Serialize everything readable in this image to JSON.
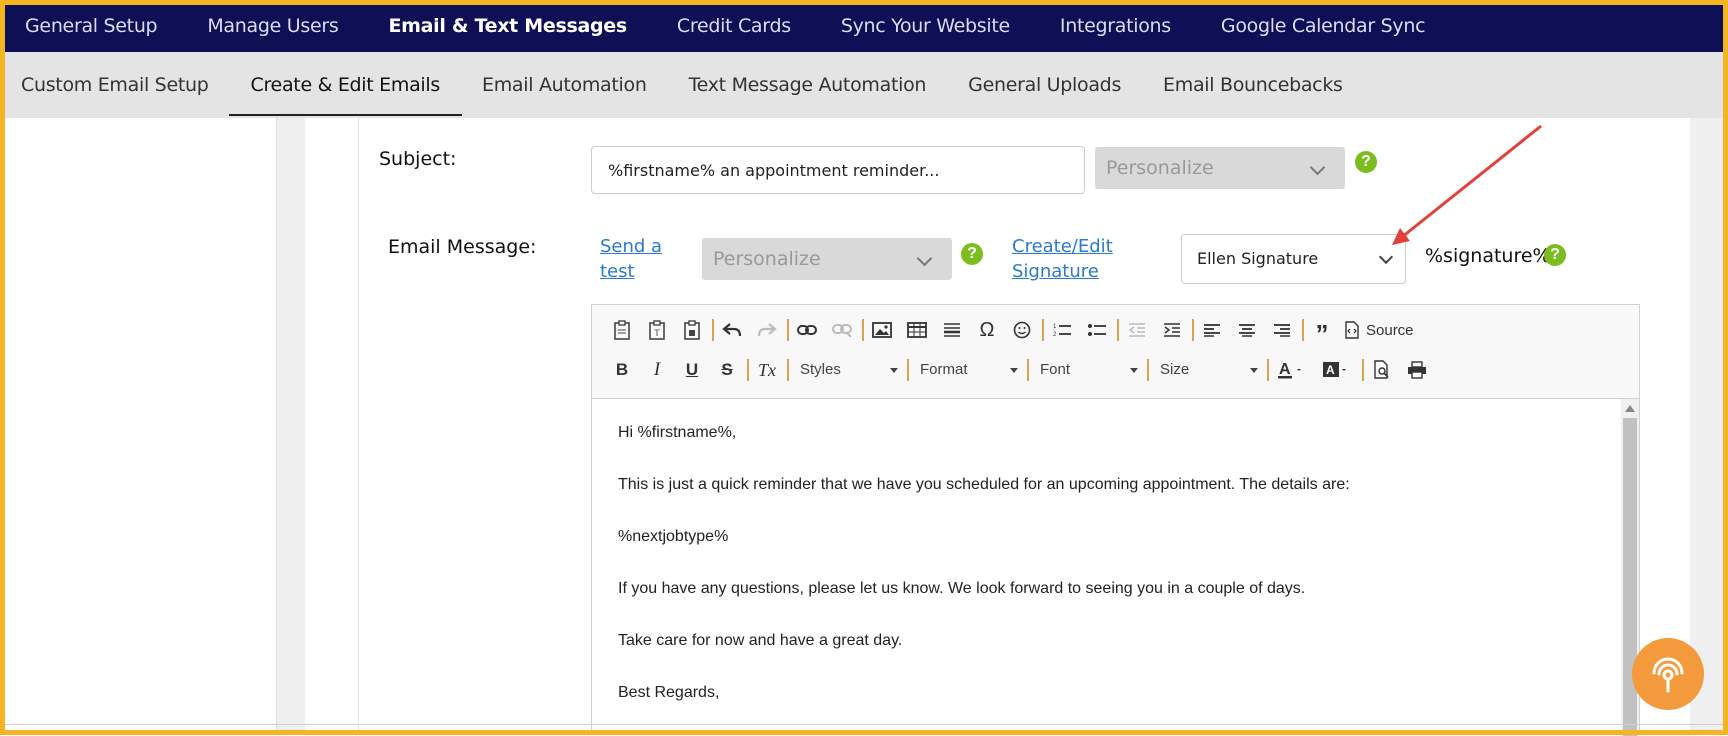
{
  "topnav": {
    "items": [
      {
        "label": "General Setup"
      },
      {
        "label": "Manage Users"
      },
      {
        "label": "Email & Text Messages",
        "active": true
      },
      {
        "label": "Credit Cards"
      },
      {
        "label": "Sync Your Website"
      },
      {
        "label": "Integrations"
      },
      {
        "label": "Google Calendar Sync"
      }
    ]
  },
  "subnav": {
    "items": [
      {
        "label": "Custom Email Setup"
      },
      {
        "label": "Create & Edit Emails",
        "active": true
      },
      {
        "label": "Email Automation"
      },
      {
        "label": "Text Message Automation"
      },
      {
        "label": "General Uploads"
      },
      {
        "label": "Email Bouncebacks"
      }
    ]
  },
  "form": {
    "subject_label": "Subject:",
    "subject_value": "%firstname% an appointment reminder...",
    "subject_personalize": "Personalize",
    "message_label": "Email Message:",
    "send_test_line1": "Send a",
    "send_test_line2": "test",
    "message_personalize": "Personalize",
    "signature_link_line1": "Create/Edit",
    "signature_link_line2": "Signature",
    "signature_selected": "Ellen Signature",
    "signature_tag": "%signature%",
    "help_glyph": "?"
  },
  "editor": {
    "source_label": "Source",
    "combos": {
      "styles": "Styles",
      "format": "Format",
      "font": "Font",
      "size": "Size"
    },
    "format_buttons": {
      "bold": "B",
      "italic": "I",
      "underline": "U",
      "strike": "S",
      "clear": "Tx"
    },
    "body": [
      "Hi %firstname%,",
      "This is just a quick reminder that we have you scheduled for an upcoming appointment. The details are:",
      "%nextjobtype%",
      "If you have any questions, please let us know. We look forward to seeing you in a couple of days.",
      "Take care for now and have a great day.",
      "Best Regards,"
    ]
  },
  "colors": {
    "topnav_bg": "#0f0f55",
    "subnav_bg": "#e4e4e4",
    "frame": "#f4b522",
    "help_green": "#7bbd1e",
    "link_blue": "#2a7ad0",
    "annotation_arrow": "#e3403c",
    "fab_orange": "#f39a3d"
  },
  "icons": {
    "fab": "broadcast-signal-icon",
    "signature_dropdown": "chevron-down-icon"
  }
}
